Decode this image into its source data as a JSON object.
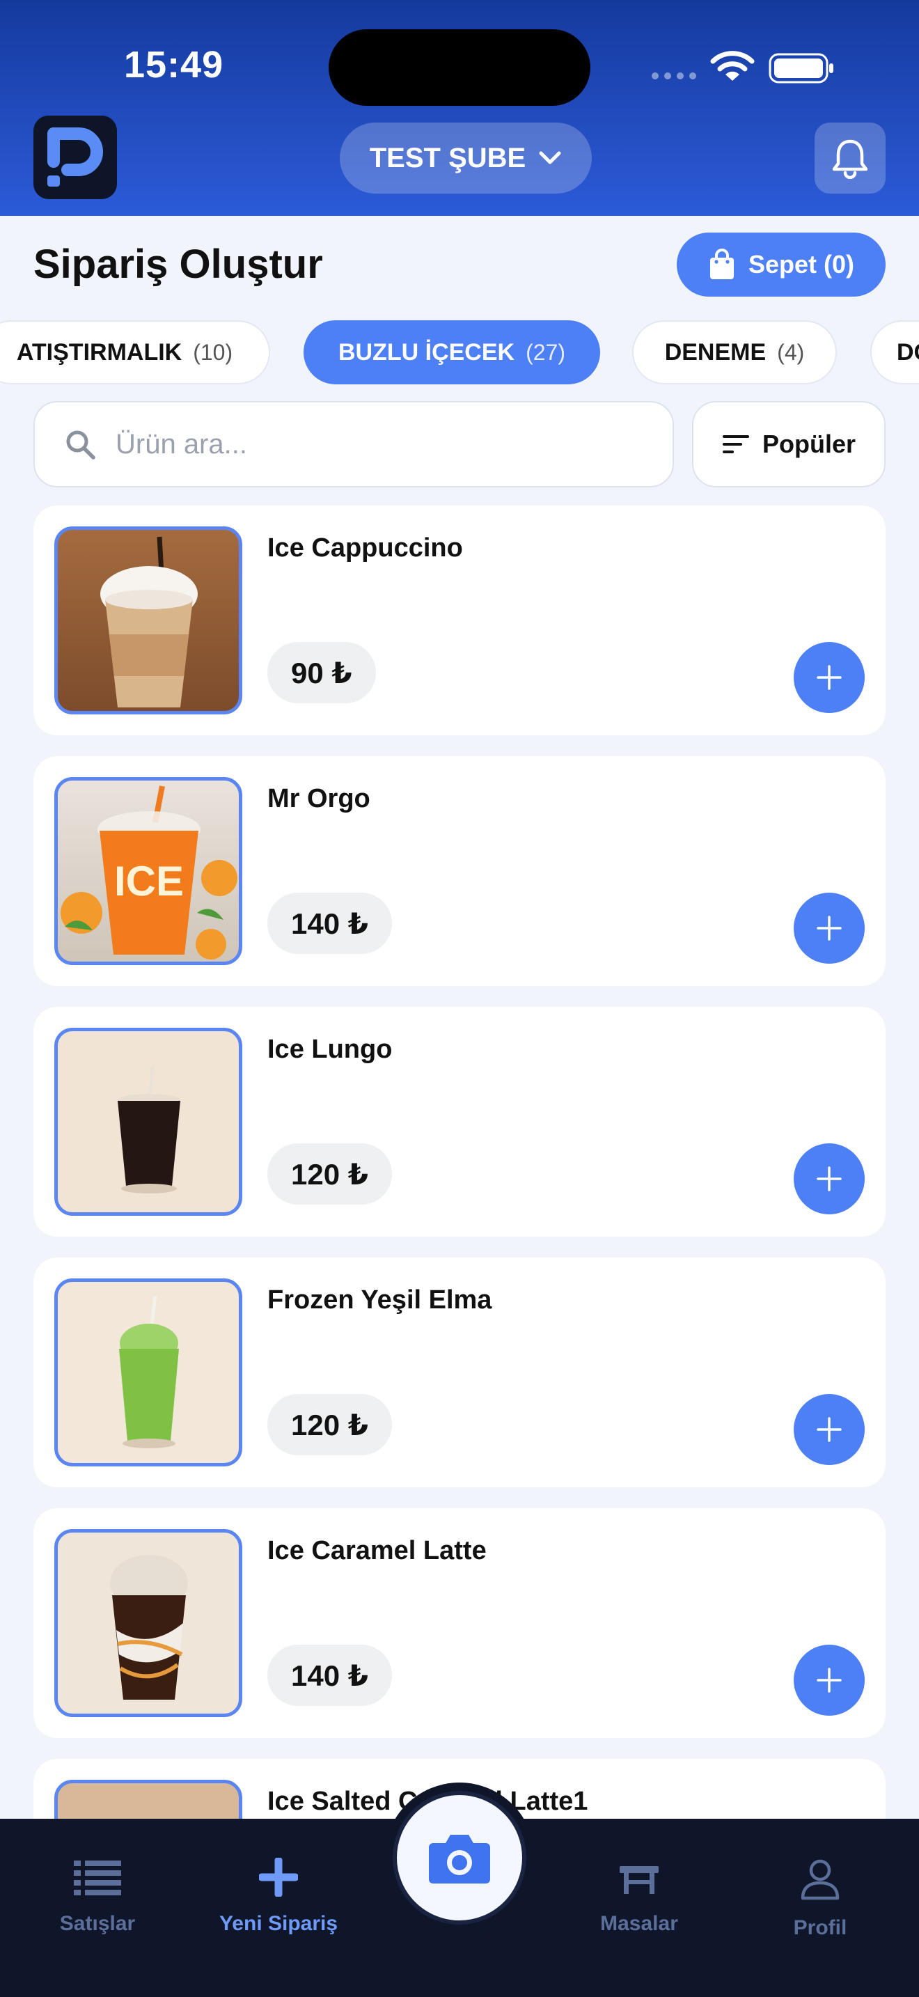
{
  "status": {
    "time": "15:49"
  },
  "header": {
    "logo_letter": "P",
    "branch_label": "TEST ŞUBE"
  },
  "page": {
    "title": "Sipariş Oluştur",
    "cart_label": "Sepet (0)"
  },
  "categories": [
    {
      "label": "ATIŞTIRMALIK",
      "count": "(10)"
    },
    {
      "label": "BUZLU İÇECEK",
      "count": "(27)"
    },
    {
      "label": "DENEME",
      "count": "(4)"
    },
    {
      "label": "DO",
      "count": ""
    }
  ],
  "search": {
    "placeholder": "Ürün ara...",
    "value": ""
  },
  "sort": {
    "label": "Popüler"
  },
  "products": [
    {
      "name": "Ice Cappuccino",
      "price": "90 ₺"
    },
    {
      "name": "Mr Orgo",
      "price": "140 ₺",
      "image_text": "ICE"
    },
    {
      "name": "Ice Lungo",
      "price": "120 ₺"
    },
    {
      "name": "Frozen Yeşil Elma",
      "price": "120 ₺"
    },
    {
      "name": "Ice Caramel Latte",
      "price": "140 ₺"
    },
    {
      "name": "Ice Salted Caramel Latte1",
      "price": ""
    }
  ],
  "nav": {
    "sales": "Satışlar",
    "new_order": "Yeni Sipariş",
    "tables": "Masalar",
    "profile": "Profil"
  },
  "colors": {
    "accent": "#4d7ff5",
    "header_top": "#153a9e",
    "header_bottom": "#2c5bd8",
    "nav_bg": "#0f1629"
  }
}
